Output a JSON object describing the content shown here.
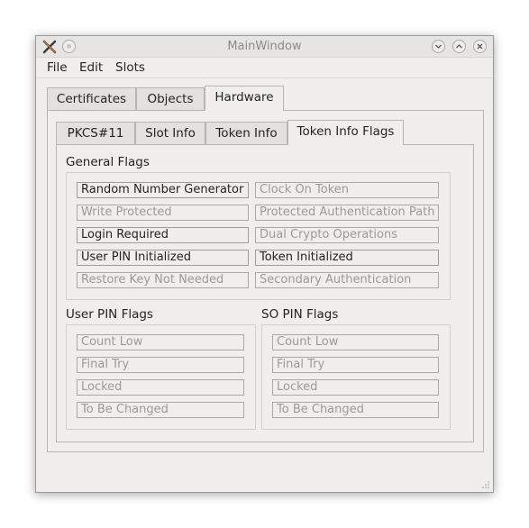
{
  "window": {
    "title": "MainWindow"
  },
  "menu": [
    "File",
    "Edit",
    "Slots"
  ],
  "main_tabs": [
    "Certificates",
    "Objects",
    "Hardware"
  ],
  "active_main_tab": "Hardware",
  "sub_tabs": [
    "PKCS#11",
    "Slot Info",
    "Token Info",
    "Token Info Flags"
  ],
  "active_sub_tab": "Token Info Flags",
  "general_flags": {
    "label": "General Flags",
    "left": [
      {
        "label": "Random Number Generator",
        "enabled": true
      },
      {
        "label": "Write Protected",
        "enabled": false
      },
      {
        "label": "Login Required",
        "enabled": true
      },
      {
        "label": "User PIN Initialized",
        "enabled": true
      },
      {
        "label": "Restore Key Not Needed",
        "enabled": false
      }
    ],
    "right": [
      {
        "label": "Clock On Token",
        "enabled": false
      },
      {
        "label": "Protected Authentication Path",
        "enabled": false
      },
      {
        "label": "Dual Crypto Operations",
        "enabled": false
      },
      {
        "label": "Token Initialized",
        "enabled": true
      },
      {
        "label": "Secondary Authentication",
        "enabled": false
      }
    ]
  },
  "user_pin_flags": {
    "label": "User PIN Flags",
    "items": [
      {
        "label": "Count Low",
        "enabled": false
      },
      {
        "label": "Final Try",
        "enabled": false
      },
      {
        "label": "Locked",
        "enabled": false
      },
      {
        "label": "To Be Changed",
        "enabled": false
      }
    ]
  },
  "so_pin_flags": {
    "label": "SO PIN Flags",
    "items": [
      {
        "label": "Count Low",
        "enabled": false
      },
      {
        "label": "Final Try",
        "enabled": false
      },
      {
        "label": "Locked",
        "enabled": false
      },
      {
        "label": "To Be Changed",
        "enabled": false
      }
    ]
  }
}
